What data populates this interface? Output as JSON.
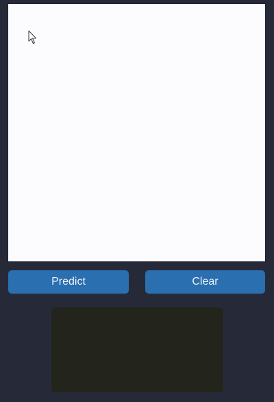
{
  "canvas": {
    "cursor_icon": "arrow-pointer-icon"
  },
  "buttons": {
    "predict_label": "Predict",
    "clear_label": "Clear"
  },
  "result": {
    "text": ""
  },
  "colors": {
    "background": "#262a38",
    "canvas": "#fcfcfe",
    "button": "#2a6faf",
    "result_panel": "#23251d"
  }
}
